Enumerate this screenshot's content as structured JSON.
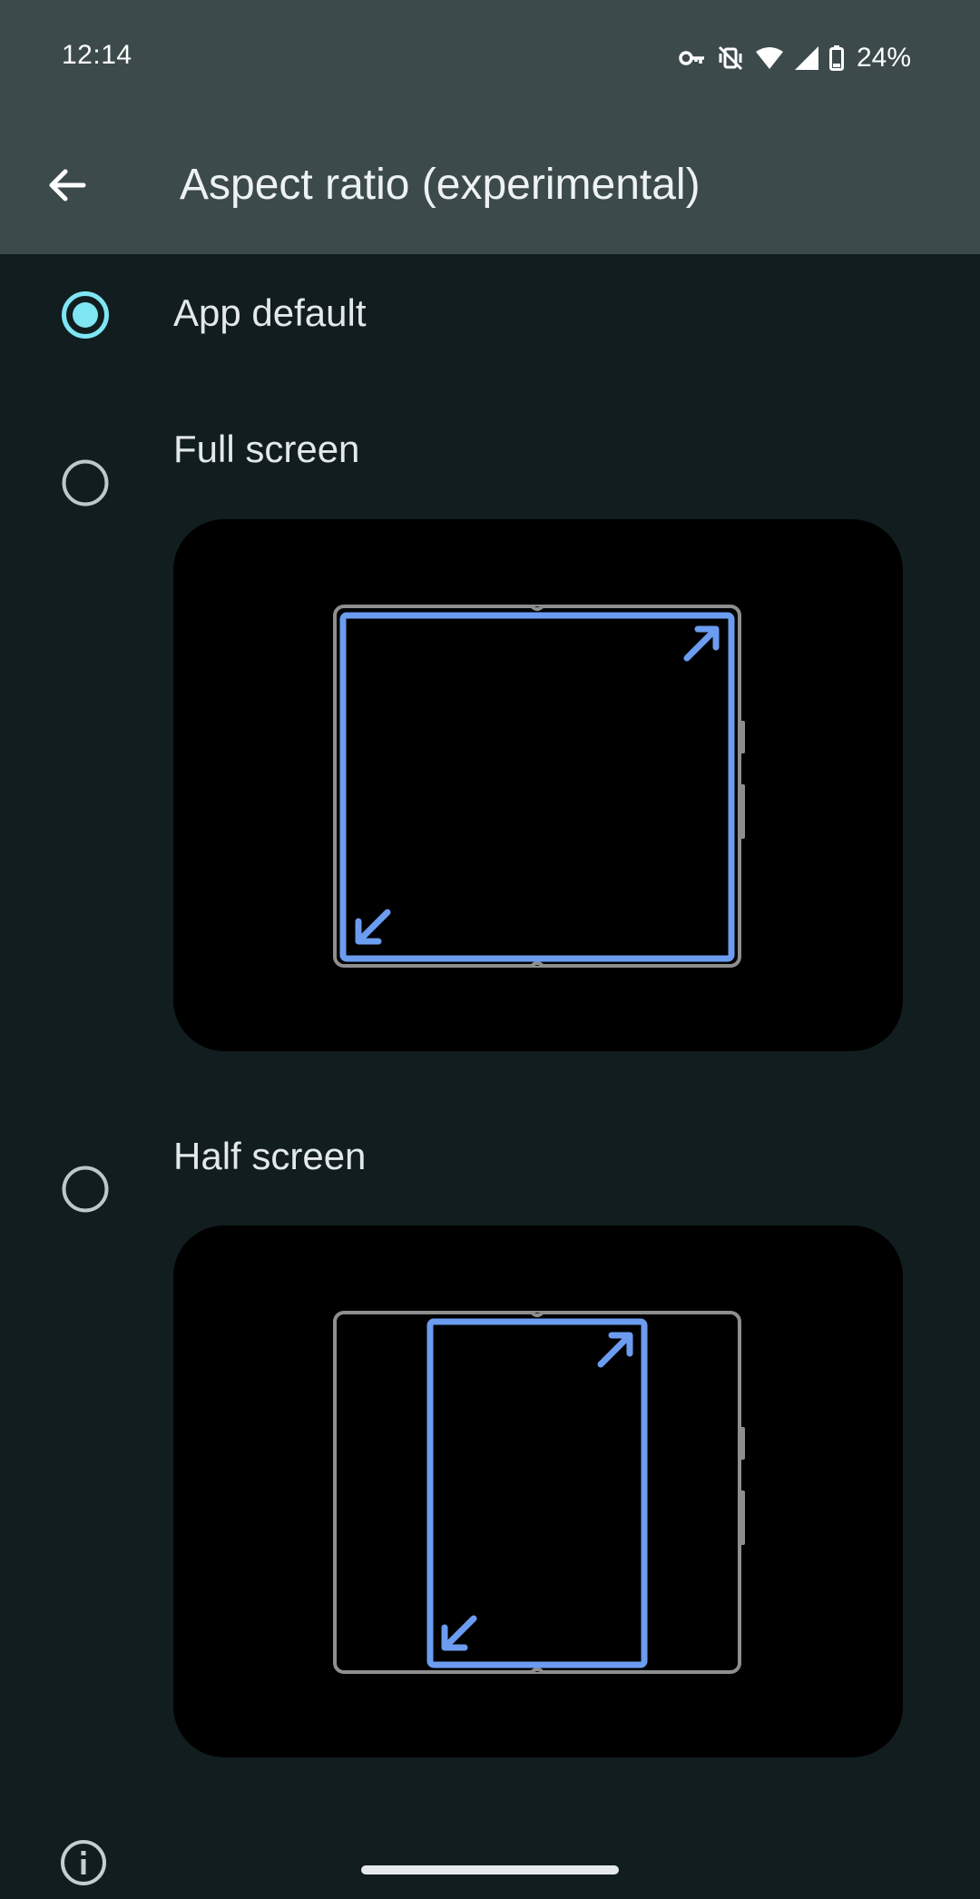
{
  "status_bar": {
    "time": "12:14",
    "icons": [
      "vpn-key-icon",
      "vibrate-off-icon",
      "wifi-icon",
      "cell-signal-icon",
      "battery-icon"
    ],
    "battery_percent": "24%"
  },
  "header": {
    "back_icon": "arrow-back-icon",
    "title": "Aspect ratio (experimental)"
  },
  "options": [
    {
      "label": "App default",
      "selected": true
    },
    {
      "label": "Full screen",
      "selected": false,
      "preview": "full-screen-foldable-illustration"
    },
    {
      "label": "Half screen",
      "selected": false,
      "preview": "half-screen-foldable-illustration"
    }
  ],
  "footer": {
    "info_icon": "info-icon"
  },
  "colors": {
    "top_bar": "#3c4a4b",
    "background": "#111d1f",
    "radio_selected": "#7fe6f3",
    "radio_unselected": "#bcc8c9",
    "illustration_accent": "#6b9cf0",
    "illustration_outline": "#8e8e8e"
  }
}
